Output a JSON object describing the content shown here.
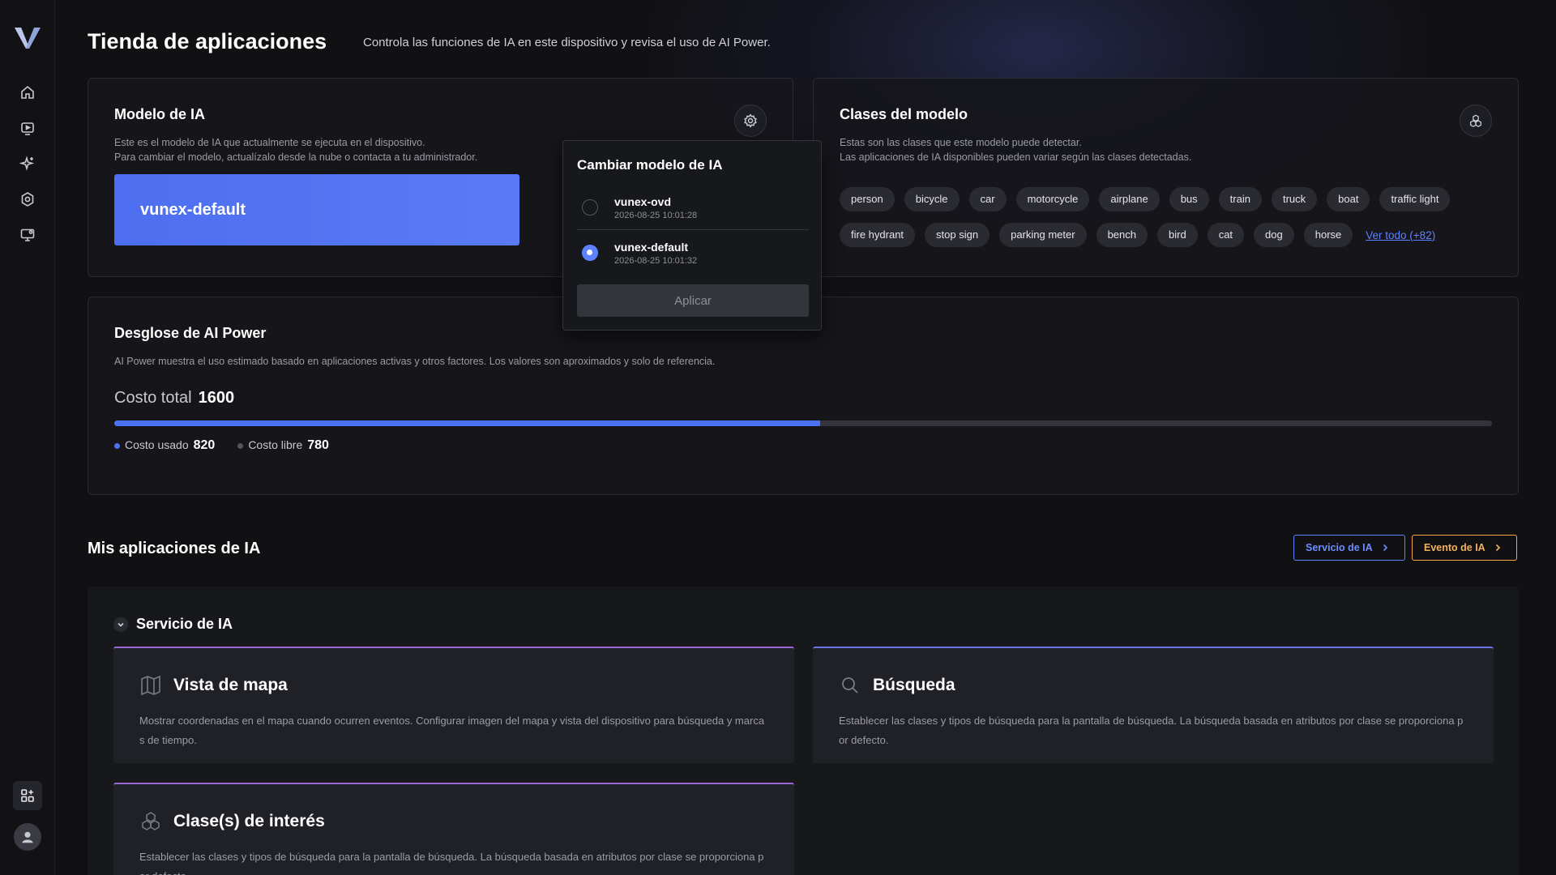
{
  "header": {
    "title": "Tienda de aplicaciones",
    "subtitle": "Controla las funciones de IA en este dispositivo y revisa el uso de AI Power."
  },
  "model_card": {
    "title": "Modelo de IA",
    "desc_line1": "Este es el modelo de IA que actualmente se ejecuta en el dispositivo.",
    "desc_line2": "Para cambiar el modelo, actualízalo desde la nube o contacta a tu administrador.",
    "current_model": "vunex-default"
  },
  "model_popup": {
    "title": "Cambiar modelo de IA",
    "options": [
      {
        "name": "vunex-ovd",
        "date": "2026-08-25 10:01:28",
        "selected": false
      },
      {
        "name": "vunex-default",
        "date": "2026-08-25 10:01:32",
        "selected": true
      }
    ],
    "apply_label": "Aplicar"
  },
  "classes_card": {
    "title": "Clases del modelo",
    "desc_line1": "Estas son las clases que este modelo puede detectar.",
    "desc_line2": "Las aplicaciones de IA disponibles pueden variar según las clases detectadas.",
    "row1": [
      "person",
      "bicycle",
      "car",
      "motorcycle",
      "airplane",
      "bus",
      "train",
      "truck",
      "boat",
      "traffic light"
    ],
    "row2": [
      "fire hydrant",
      "stop sign",
      "parking meter",
      "bench",
      "bird",
      "cat",
      "dog",
      "horse"
    ],
    "see_all": "Ver todo (+82)"
  },
  "power": {
    "title": "Desglose de AI Power",
    "desc": "AI Power muestra el uso estimado basado en aplicaciones activas y otros factores. Los valores son aproximados y solo de referencia.",
    "total_label": "Costo total",
    "total_value": "1600",
    "used_label": "Costo usado",
    "used_value": "820",
    "free_label": "Costo libre",
    "free_value": "780",
    "used_fraction": 0.5125,
    "used_color": "#4b72f5",
    "free_color": "#55565d"
  },
  "apps": {
    "title": "Mis aplicaciones de IA",
    "btn_service": "Servicio de IA",
    "btn_event": "Evento de IA",
    "service_section": "Servicio de IA",
    "cards": [
      {
        "icon": "map-icon",
        "title": "Vista de mapa",
        "desc": "Mostrar coordenadas en el mapa cuando ocurren eventos. Configurar imagen del mapa y vista del dispositivo para búsqueda y marca s de tiempo."
      },
      {
        "icon": "search-icon",
        "title": "Búsqueda",
        "desc": "Establecer las clases y tipos de búsqueda para la pantalla de búsqueda. La búsqueda basada en atributos por clase se proporciona p or defecto."
      },
      {
        "icon": "cubes-icon",
        "title": "Clase(s) de interés",
        "desc": "Establecer las clases y tipos de búsqueda para la pantalla de búsqueda. La búsqueda basada en atributos por clase se proporciona p or defecto."
      }
    ]
  },
  "colors": {
    "accent": "#5e82ff",
    "event_accent": "#f3b15a",
    "background": "#111114"
  }
}
